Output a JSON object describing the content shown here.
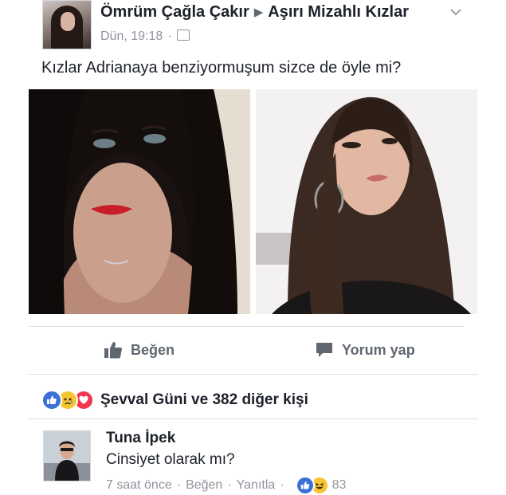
{
  "post": {
    "author": "Ömrüm Çağla Çakır",
    "arrow": "▶",
    "group": "Aşırı Mizahlı Kızlar",
    "time": "Dün, 19:18",
    "dot": "·",
    "text": "Kızlar Adrianaya benziyormuşum sizce de öyle mi?"
  },
  "actions": {
    "like": "Beğen",
    "comment": "Yorum yap"
  },
  "reactions": {
    "summary": "Şevval Güni ve 382 diğer kişi",
    "icons": [
      "like-icon",
      "sad-icon",
      "love-icon"
    ]
  },
  "comment": {
    "author": "Tuna İpek",
    "text": "Cinsiyet olarak mı?",
    "time": "7 saat önce",
    "sep": "·",
    "like": "Beğen",
    "reply": "Yanıtla",
    "reaction_count": "83",
    "reaction_icons": [
      "like-icon",
      "haha-icon"
    ]
  },
  "colors": {
    "text": "#1d2129",
    "muted": "#90949c",
    "like_blue": "#3b6fd8",
    "love_red": "#f0384e",
    "emoji_yellow": "#f7c531"
  }
}
